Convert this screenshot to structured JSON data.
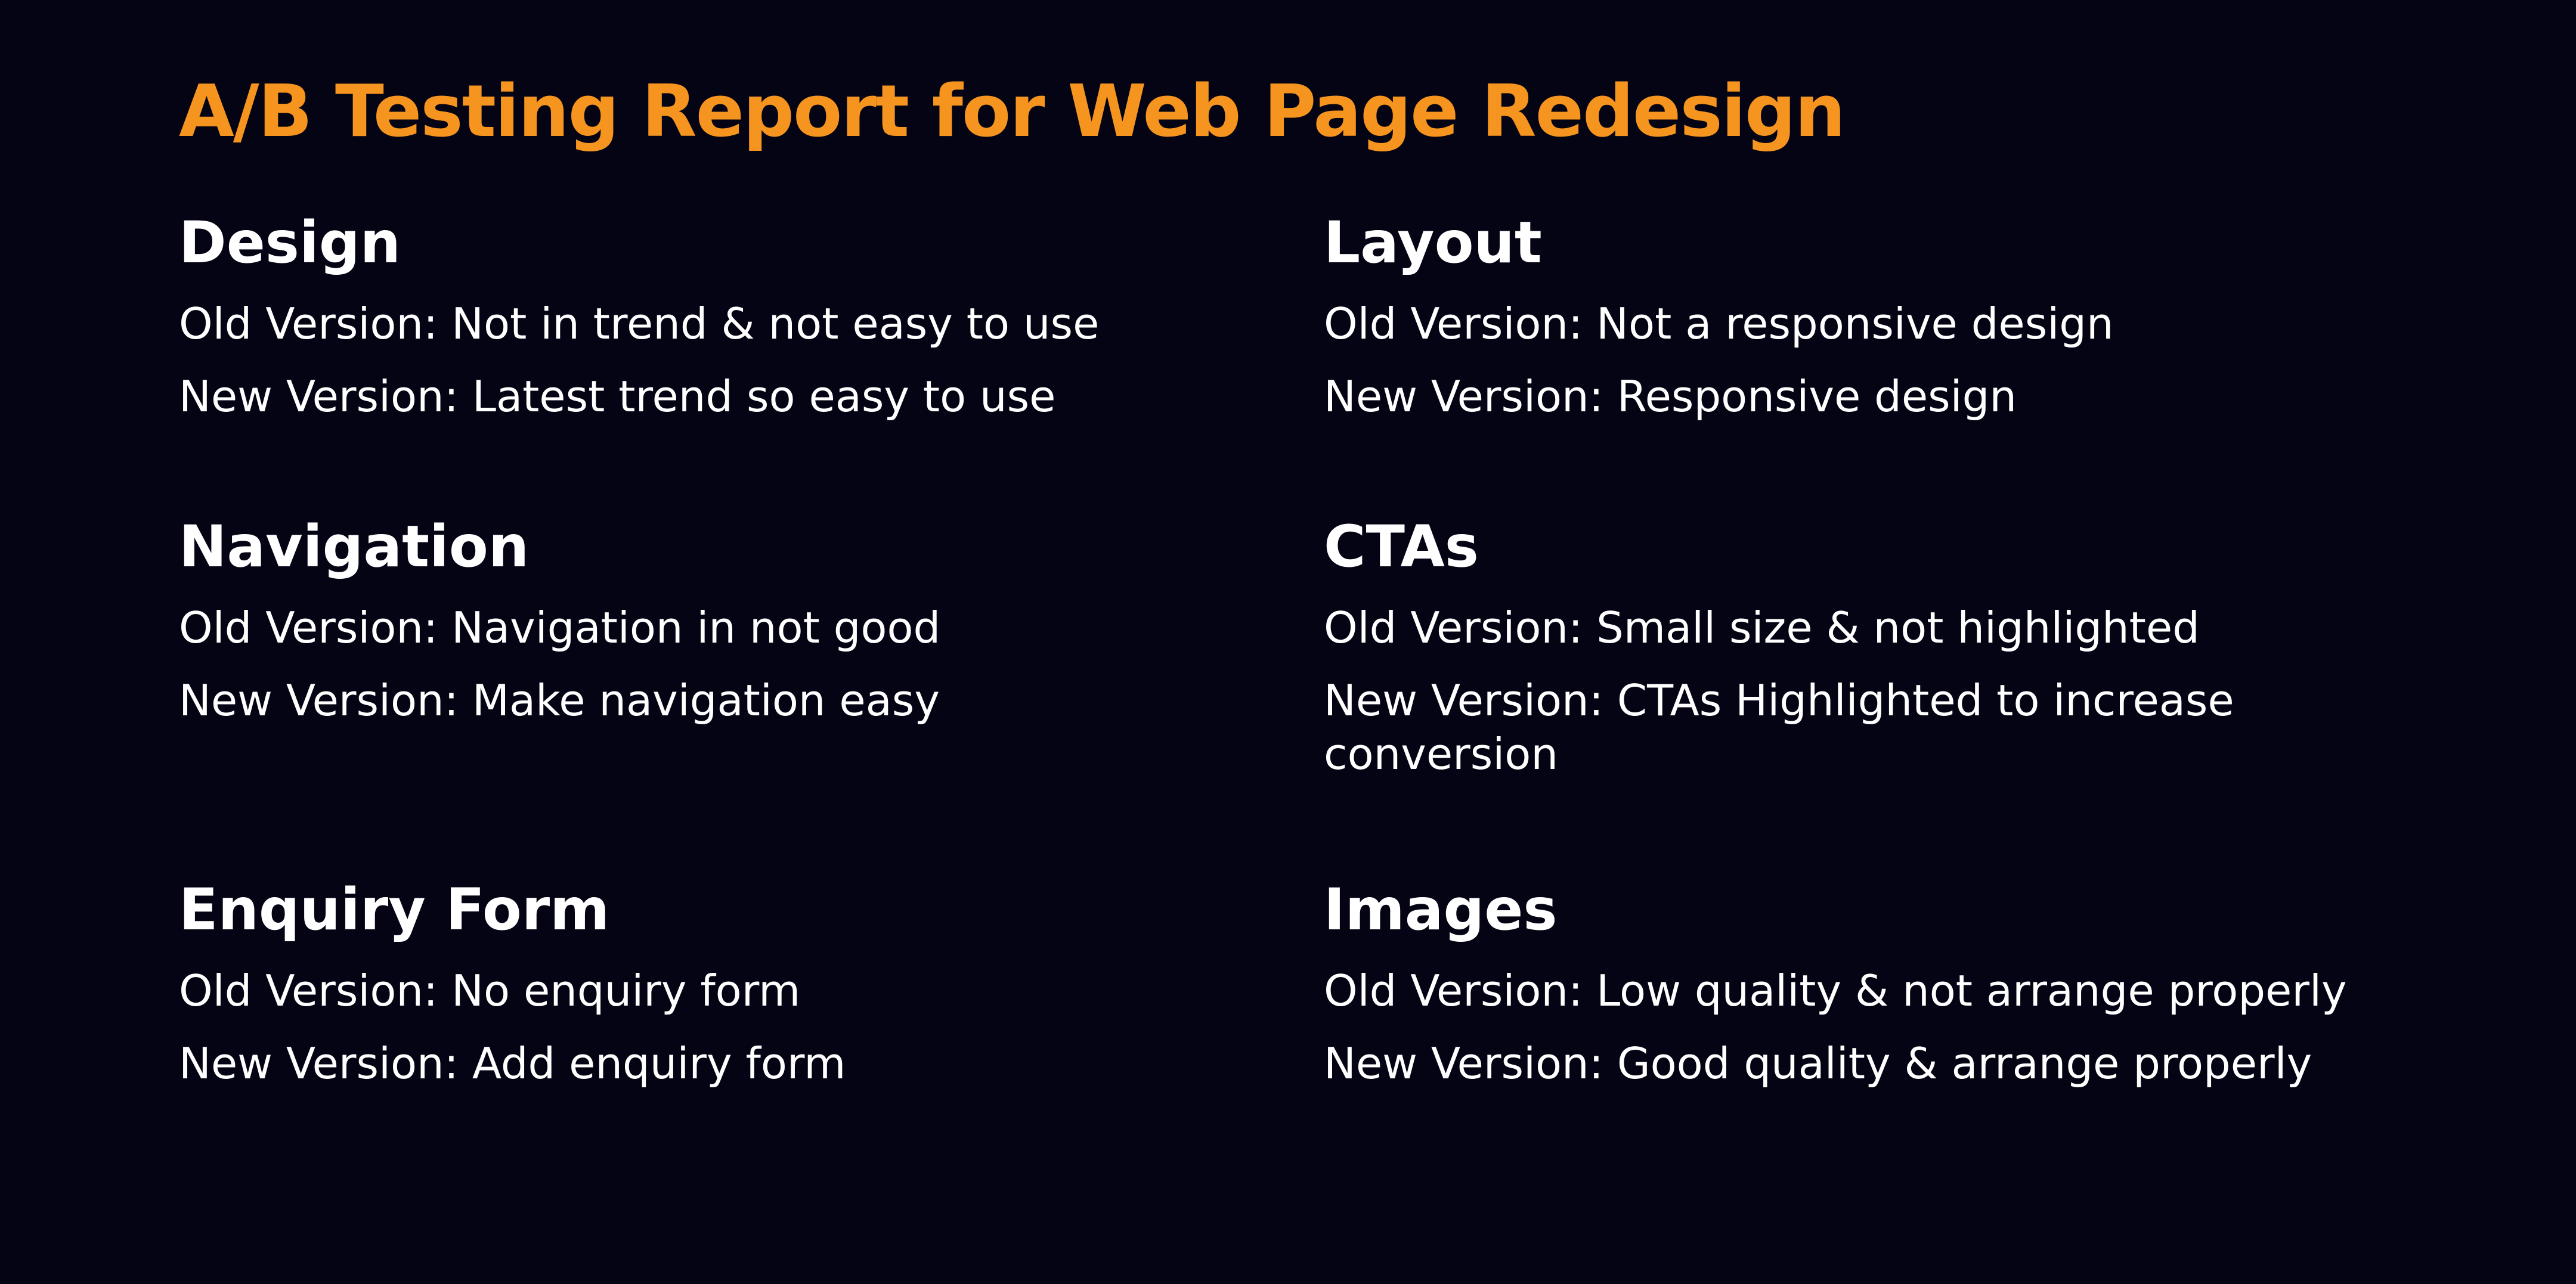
{
  "title": "A/B Testing Report for Web Page Redesign",
  "sections": [
    {
      "heading": "Design",
      "old": "Old Version: Not in trend & not easy to use",
      "new": "New Version: Latest trend so easy to use"
    },
    {
      "heading": "Layout",
      "old": "Old Version: Not a responsive design",
      "new": "New Version: Responsive design"
    },
    {
      "heading": "Navigation",
      "old": "Old Version: Navigation in not good",
      "new": "New Version: Make navigation easy"
    },
    {
      "heading": "CTAs",
      "old": "Old Version: Small size  & not highlighted",
      "new": "New Version: CTAs Highlighted  to increase conversion"
    },
    {
      "heading": "Enquiry Form",
      "old": "Old Version: No enquiry form",
      "new": "New Version: Add enquiry form"
    },
    {
      "heading": "Images",
      "old": "Old Version: Low quality & not arrange properly",
      "new": "New Version: Good quality & arrange properly"
    }
  ],
  "colors": {
    "background": "#050414",
    "title": "#f5941e",
    "text": "#ffffff"
  }
}
